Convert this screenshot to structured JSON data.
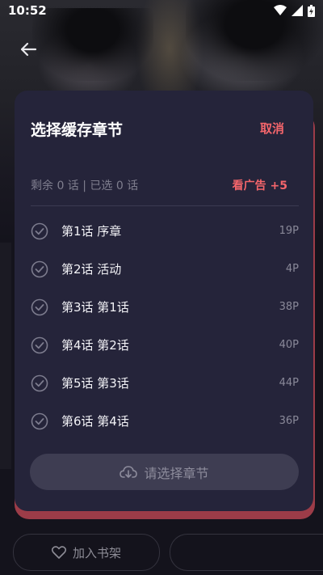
{
  "status_bar": {
    "time": "10:52"
  },
  "modal": {
    "title": "选择缓存章节",
    "cancel_label": "取消",
    "summary": "剩余 0 话 | 已选 0 话",
    "ad_label": "看广告 +5",
    "download_label": "请选择章节",
    "chapters": [
      {
        "label": "第1话 序章",
        "pages": "19P"
      },
      {
        "label": "第2话 活动",
        "pages": "4P"
      },
      {
        "label": "第3话 第1话",
        "pages": "38P"
      },
      {
        "label": "第4话 第2话",
        "pages": "40P"
      },
      {
        "label": "第5话 第3话",
        "pages": "44P"
      },
      {
        "label": "第6话 第4话",
        "pages": "36P"
      }
    ]
  },
  "bottom_bar": {
    "shelf_label": "加入书架"
  },
  "colors": {
    "accent": "#f4656b",
    "modal_bg": "#25243a",
    "button_bg": "#3e3d52"
  }
}
